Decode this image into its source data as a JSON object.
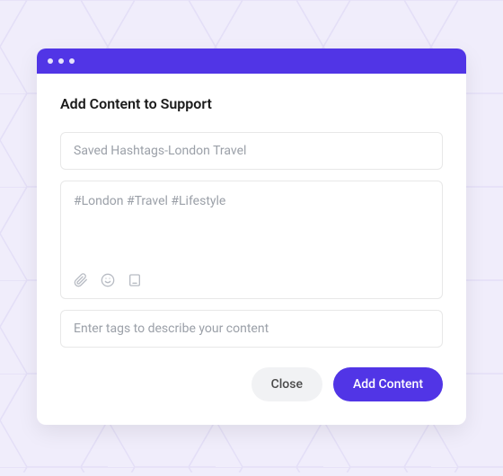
{
  "modal": {
    "title": "Add Content to Support",
    "title_input": {
      "placeholder": "Saved Hashtags-London Travel"
    },
    "body_textarea": {
      "placeholder": "#London #Travel #Lifestyle"
    },
    "tags_input": {
      "placeholder": "Enter tags to describe your content"
    },
    "actions": {
      "close_label": "Close",
      "submit_label": "Add Content"
    }
  },
  "colors": {
    "primary": "#5135E6",
    "background": "#f0edfb"
  }
}
